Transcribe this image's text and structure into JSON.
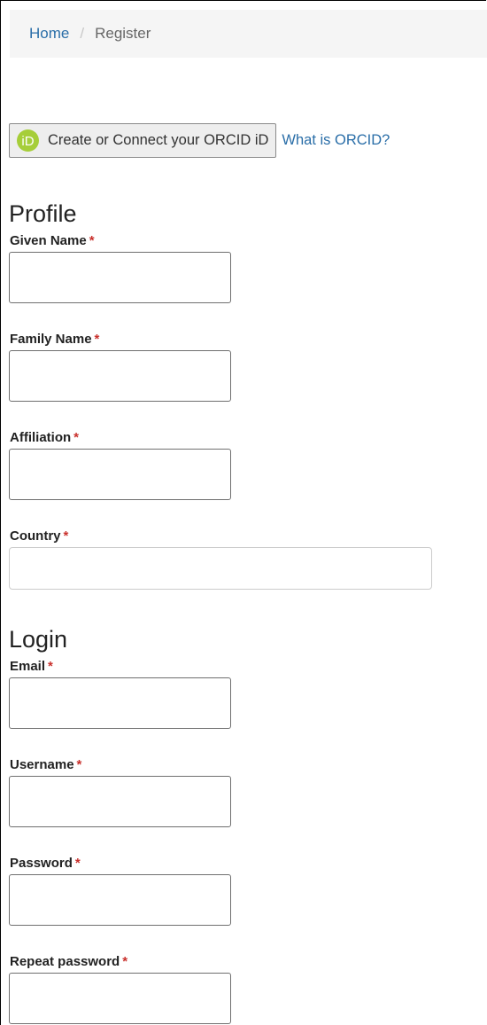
{
  "breadcrumb": {
    "home": "Home",
    "separator": "/",
    "current": "Register"
  },
  "orcid": {
    "button_label": "Create or Connect your ORCID iD",
    "icon_text": "iD",
    "link_label": "What is ORCID?",
    "icon_color": "#a6ce39"
  },
  "profile": {
    "title": "Profile",
    "given_name": "Given Name",
    "family_name": "Family Name",
    "affiliation": "Affiliation",
    "country": "Country"
  },
  "login": {
    "title": "Login",
    "email": "Email",
    "username": "Username",
    "password": "Password",
    "repeat_password": "Repeat password"
  },
  "required_marker": "*",
  "colors": {
    "link": "#2a6ea8",
    "required": "#c9302c",
    "breadcrumb_bg": "#f5f5f5"
  }
}
